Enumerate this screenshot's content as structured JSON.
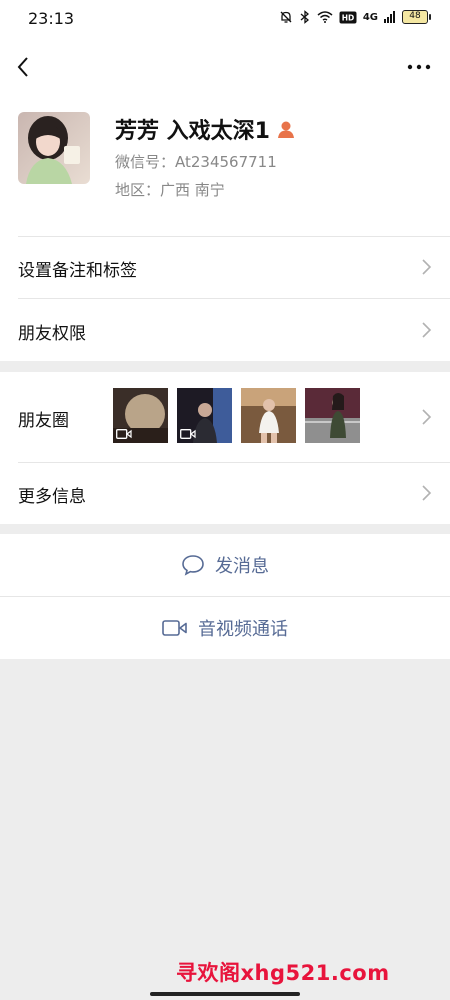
{
  "status_bar": {
    "time": "23:13",
    "signal_text": "4G",
    "battery": "48",
    "icons": [
      "bell-off-icon",
      "bluetooth-icon",
      "wifi-icon",
      "hd-icon",
      "signal-icon",
      "battery-icon"
    ]
  },
  "nav": {
    "back_icon": "chevron-left-icon",
    "more_icon": "more-dots-icon"
  },
  "profile": {
    "name": "芳芳 入戏太深1",
    "wechat_id": "微信号：At234567711",
    "region": "地区：广西  南宁",
    "gender_icon_color": "#e8734a"
  },
  "rows": {
    "set_remark": "设置备注和标签",
    "friend_permissions": "朋友权限",
    "moments": "朋友圈",
    "more_info": "更多信息"
  },
  "actions": {
    "send_message": "发消息",
    "video_call": "音视频通话"
  },
  "watermark": "寻欢阁xhg521.com",
  "colors": {
    "link_blue": "#576b95",
    "background": "#ededed",
    "watermark_red": "#e8143c"
  }
}
